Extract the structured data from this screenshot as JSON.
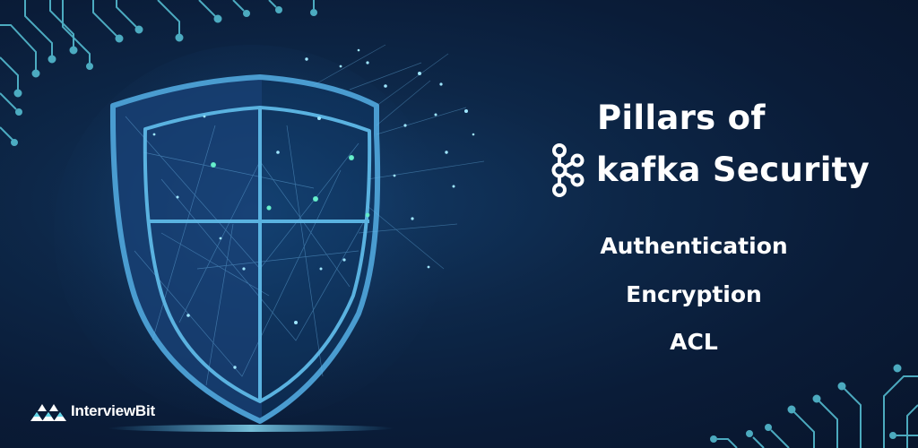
{
  "title": {
    "line1": "Pillars of",
    "line2": "kafka Security"
  },
  "pillars": [
    "Authentication",
    "Encryption",
    "ACL"
  ],
  "brand": {
    "name": "InterviewBit"
  },
  "icons": {
    "title_icon": "kafka-logo-icon",
    "brand_icon": "interviewbit-logo-icon",
    "art": "shield-icon"
  },
  "colors": {
    "background": "#0a1c38",
    "accent": "#5fd6e8",
    "text": "#ffffff"
  }
}
